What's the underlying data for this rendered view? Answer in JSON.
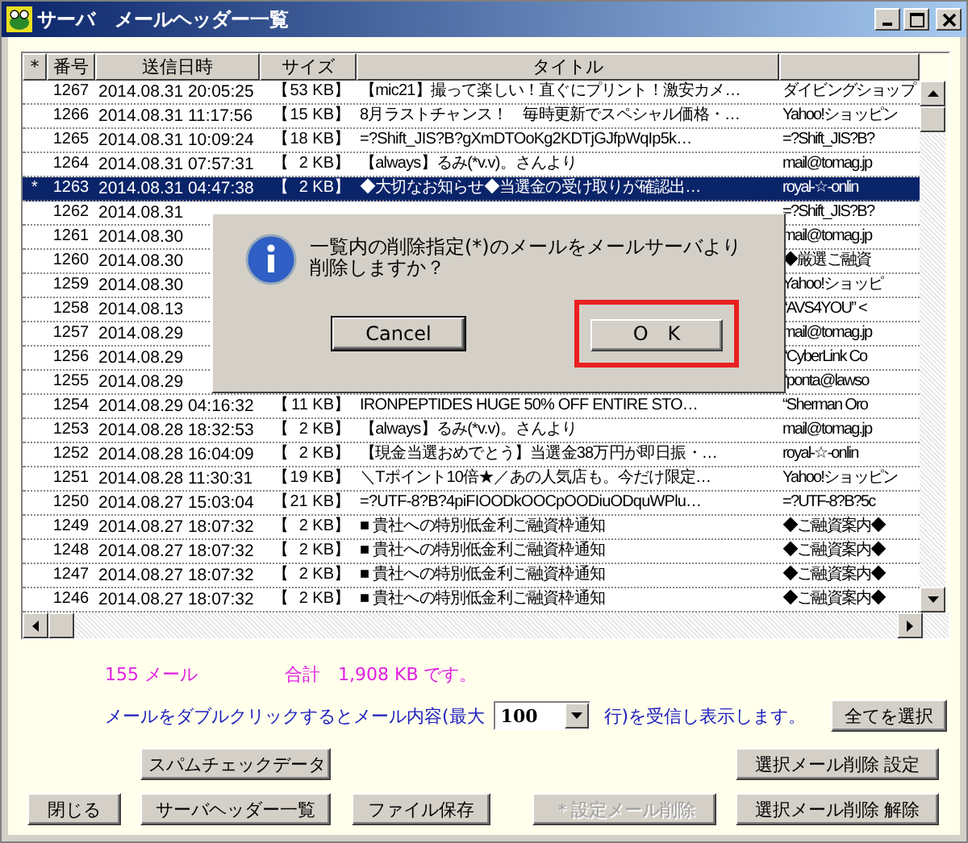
{
  "window": {
    "title": "サーバ　メールヘッダー一覧"
  },
  "table": {
    "columns": [
      "*",
      "番号",
      "送信日時",
      "サイズ",
      "タイトル"
    ],
    "rows": [
      {
        "mark": "",
        "number": "1267",
        "date": "2014.08.31 20:05:25",
        "size_open": "【",
        "size": "53 KB】",
        "title": "【mic21】撮って楽しい！直ぐにプリント！激安カメ…",
        "from": "ダイビングショップ",
        "selected": false
      },
      {
        "mark": "",
        "number": "1266",
        "date": "2014.08.31 11:17:56",
        "size_open": "【",
        "size": "15 KB】",
        "title": "8月ラストチャンス！　毎時更新でスペシャル価格・…",
        "from": "Yahoo!ショッピン",
        "selected": false
      },
      {
        "mark": "",
        "number": "1265",
        "date": "2014.08.31 10:09:24",
        "size_open": "【",
        "size": "18 KB】",
        "title": "=?Shift_JIS?B?gXmDTOoKg2KDTjGJfpWqIp5k…",
        "from": "=?Shift_JIS?B?",
        "selected": false
      },
      {
        "mark": "",
        "number": "1264",
        "date": "2014.08.31 07:57:31",
        "size_open": "【",
        "size": "2 KB】",
        "title": "【always】るみ(*v.v)。さんより",
        "from": "mail@tomag.jp",
        "selected": false
      },
      {
        "mark": "*",
        "number": "1263",
        "date": "2014.08.31 04:47:38",
        "size_open": "【",
        "size": "2 KB】",
        "title": "◆大切なお知らせ◆当選金の受け取りが確認出…",
        "from": "royal-☆-onlin",
        "selected": true
      },
      {
        "mark": "",
        "number": "1262",
        "date": "2014.08.31",
        "from": "=?Shift_JIS?B?",
        "selected": false
      },
      {
        "mark": "",
        "number": "1261",
        "date": "2014.08.30",
        "from": "mail@tomag.jp",
        "selected": false
      },
      {
        "mark": "",
        "number": "1260",
        "date": "2014.08.30",
        "from": "◆厳選ご融資",
        "selected": false
      },
      {
        "mark": "",
        "number": "1259",
        "date": "2014.08.30",
        "from": "Yahoo!ショッピ",
        "selected": false
      },
      {
        "mark": "",
        "number": "1258",
        "date": "2014.08.13",
        "from": "“AVS4YOU” <",
        "selected": false
      },
      {
        "mark": "",
        "number": "1257",
        "date": "2014.08.29",
        "from": "mail@tomag.jp",
        "selected": false
      },
      {
        "mark": "",
        "number": "1256",
        "date": "2014.08.29",
        "from": "“CyberLink Co",
        "selected": false
      },
      {
        "mark": "",
        "number": "1255",
        "date": "2014.08.29",
        "from": "“ponta@lawso",
        "selected": false
      },
      {
        "mark": "",
        "number": "1254",
        "date": "2014.08.29 04:16:32",
        "size_open": "【",
        "size": "11 KB】",
        "title": "IRONPEPTIDES HUGE 50% OFF ENTIRE STO…",
        "from": "“Sherman Oro",
        "selected": false
      },
      {
        "mark": "",
        "number": "1253",
        "date": "2014.08.28 18:32:53",
        "size_open": "【",
        "size": "2 KB】",
        "title": "【always】るみ(*v.v)。さんより",
        "from": "mail@tomag.jp",
        "selected": false
      },
      {
        "mark": "",
        "number": "1252",
        "date": "2014.08.28 16:04:09",
        "size_open": "【",
        "size": "2 KB】",
        "title": "【現金当選おめでとう】当選金38万円が即日振・…",
        "from": "royal-☆-onlin",
        "selected": false
      },
      {
        "mark": "",
        "number": "1251",
        "date": "2014.08.28 11:30:31",
        "size_open": "【",
        "size": "19 KB】",
        "title": "＼Tポイント10倍★／あの人気店も。今だけ限定…",
        "from": "Yahoo!ショッピン",
        "selected": false
      },
      {
        "mark": "",
        "number": "1250",
        "date": "2014.08.27 15:03:04",
        "size_open": "【",
        "size": "21 KB】",
        "title": "=?UTF-8?B?4piFIOODkOOCpOODiuODquWPlu…",
        "from": "=?UTF-8?B?5c",
        "selected": false
      },
      {
        "mark": "",
        "number": "1249",
        "date": "2014.08.27 18:07:32",
        "size_open": "【",
        "size": "2 KB】",
        "title": "■ 貴社への特別低金利ご融資枠通知",
        "from": "◆ご融資案内◆",
        "selected": false
      },
      {
        "mark": "",
        "number": "1248",
        "date": "2014.08.27 18:07:32",
        "size_open": "【",
        "size": "2 KB】",
        "title": "■ 貴社への特別低金利ご融資枠通知",
        "from": "◆ご融資案内◆",
        "selected": false
      },
      {
        "mark": "",
        "number": "1247",
        "date": "2014.08.27 18:07:32",
        "size_open": "【",
        "size": "2 KB】",
        "title": "■ 貴社への特別低金利ご融資枠通知",
        "from": "◆ご融資案内◆",
        "selected": false
      },
      {
        "mark": "",
        "number": "1246",
        "date": "2014.08.27 18:07:32",
        "size_open": "【",
        "size": "2 KB】",
        "title": "■ 貴社への特別低金利ご融資枠通知",
        "from": "◆ご融資案内◆",
        "selected": false
      }
    ]
  },
  "dialog": {
    "message": [
      "一覧内の削除指定(*)のメールをメールサーバより",
      "削除しますか？"
    ],
    "buttons": [
      {
        "label": "Cancel",
        "highlighted": false
      },
      {
        "label": "O　K",
        "highlighted": true
      }
    ]
  },
  "summary": {
    "count": "155 メール",
    "total": "合計　1,908 KB です。"
  },
  "fetch": {
    "before": "メールをダブルクリックするとメール内容(最大",
    "limit": "100",
    "after": "行)を受信し表示します。",
    "select_all": "全てを選択"
  },
  "buttons_upper": [
    {
      "label": "スパムチェックデータ",
      "disabled": false
    },
    {
      "label": "選択メール削除 設定",
      "disabled": false
    }
  ],
  "buttons_lower": [
    {
      "label": "閉じる",
      "disabled": false
    },
    {
      "label": "サーバヘッダー一覧",
      "disabled": false
    },
    {
      "label": "ファイル保存",
      "disabled": false
    },
    {
      "label": "＊設定メール削除",
      "disabled": true
    },
    {
      "label": "選択メール削除 解除",
      "disabled": false
    }
  ]
}
